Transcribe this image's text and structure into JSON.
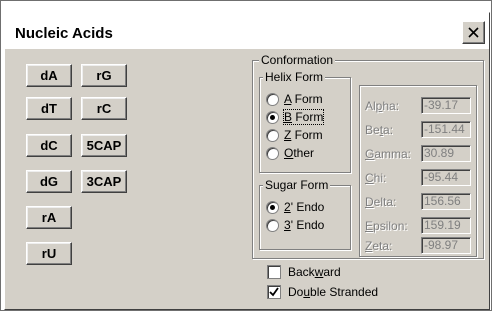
{
  "window": {
    "title": "Nucleic Acids",
    "close_icon": "close-icon"
  },
  "buttons": {
    "dA": "dA",
    "rG": "rG",
    "dT": "dT",
    "rC": "rC",
    "dC": "dC",
    "5CAP": "5CAP",
    "dG": "dG",
    "3CAP": "3CAP",
    "rA": "rA",
    "rU": "rU"
  },
  "conformation": {
    "legend": "Conformation",
    "helix_form": {
      "legend": "Helix Form",
      "options": [
        {
          "pre": "",
          "key": "A",
          "post": " Form",
          "selected": false
        },
        {
          "pre": "",
          "key": "B",
          "post": " Form",
          "selected": true
        },
        {
          "pre": "",
          "key": "Z",
          "post": " Form",
          "selected": false
        },
        {
          "pre": "",
          "key": "O",
          "post": "ther",
          "selected": false
        }
      ]
    },
    "sugar_form": {
      "legend": "Sugar Form",
      "options": [
        {
          "key": "2",
          "post": "' Endo",
          "selected": true
        },
        {
          "key": "3",
          "post": "' Endo",
          "selected": false
        }
      ]
    },
    "parameters": [
      {
        "pre": "Al",
        "key": "p",
        "post": "ha:",
        "value": "-39.17"
      },
      {
        "pre": "Be",
        "key": "t",
        "post": "a:",
        "value": "-151.44"
      },
      {
        "pre": "",
        "key": "G",
        "post": "amma:",
        "value": "30.89"
      },
      {
        "pre": "",
        "key": "C",
        "post": "hi:",
        "value": "-95.44"
      },
      {
        "pre": "",
        "key": "D",
        "post": "elta:",
        "value": "156.56"
      },
      {
        "pre": "",
        "key": "E",
        "post": "psilon:",
        "value": "159.19"
      },
      {
        "pre": "",
        "key": "Z",
        "post": "eta:",
        "value": "-98.97"
      }
    ]
  },
  "options": {
    "backward": {
      "pre": "Back",
      "key": "w",
      "post": "ard",
      "checked": false
    },
    "double_stranded": {
      "pre": "Do",
      "key": "u",
      "post": "ble Stranded",
      "checked": true
    }
  }
}
